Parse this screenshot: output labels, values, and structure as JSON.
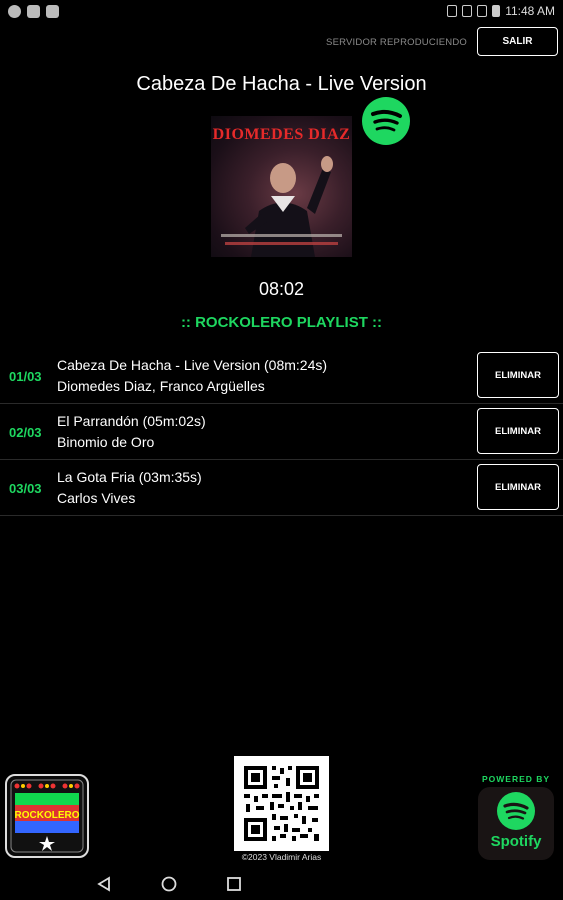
{
  "status_bar": {
    "time": "11:48 AM"
  },
  "header": {
    "server_status": "SERVIDOR REPRODUCIENDO",
    "exit_label": "SALIR"
  },
  "now_playing": {
    "title": "Cabeza De Hacha - Live Version",
    "album_artist_text": "DIOMEDES DIAZ",
    "elapsed": "08:02"
  },
  "playlist": {
    "heading": ":: ROCKOLERO PLAYLIST ::",
    "items": [
      {
        "num": "01/03",
        "title": "Cabeza De Hacha - Live Version (08m:24s)",
        "artist": "Diomedes Diaz, Franco Argüelles",
        "remove_label": "ELIMINAR"
      },
      {
        "num": "02/03",
        "title": "El Parrandón (05m:02s)",
        "artist": "Binomio de Oro",
        "remove_label": "ELIMINAR"
      },
      {
        "num": "03/03",
        "title": "La Gota Fria (03m:35s)",
        "artist": "Carlos Vives",
        "remove_label": "ELIMINAR"
      }
    ]
  },
  "footer": {
    "logo_text": "ROCKOLERO",
    "copyright": "©2023 Vladimir Arias",
    "powered_by": "POWERED BY",
    "spotify_label": "Spotify"
  },
  "colors": {
    "accent_green": "#1ed760",
    "background": "#000000"
  },
  "icons": {
    "spotify": "spotify-icon",
    "qr": "qr-code",
    "nav_back": "back-triangle-icon",
    "nav_home": "home-circle-icon",
    "nav_recents": "recents-square-icon"
  }
}
